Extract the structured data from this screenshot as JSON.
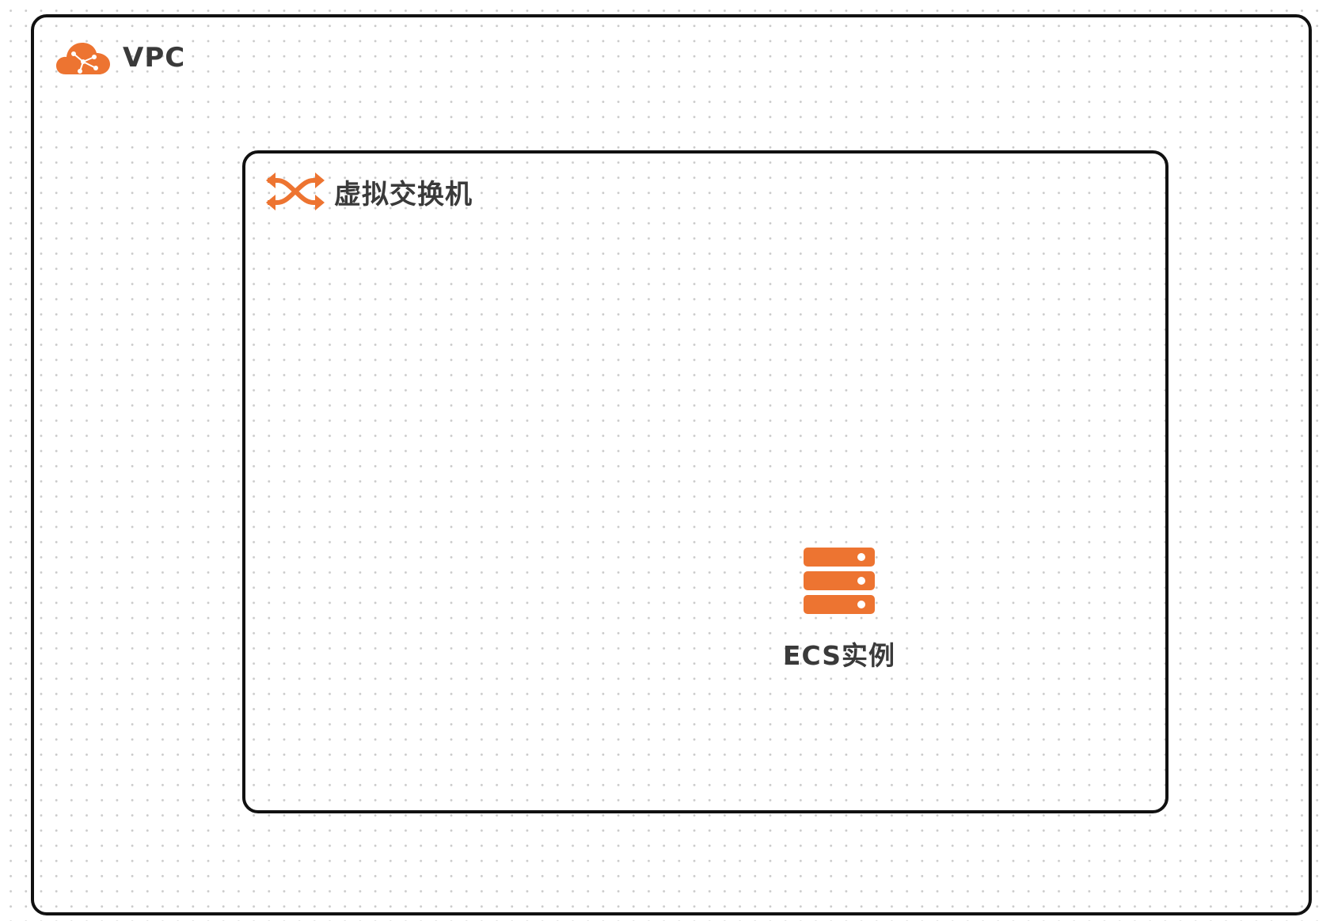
{
  "colors": {
    "accent": "#ed7431",
    "border": "#111111",
    "text": "#3a3a3a",
    "grid_dot": "#c9c9c9"
  },
  "vpc": {
    "title": "VPC",
    "icon": "cloud-network-icon"
  },
  "vswitch": {
    "title": "虚拟交换机",
    "icon": "switch-arrows-icon"
  },
  "ecs": {
    "label": "ECS实例",
    "icon": "server-stack-icon"
  }
}
